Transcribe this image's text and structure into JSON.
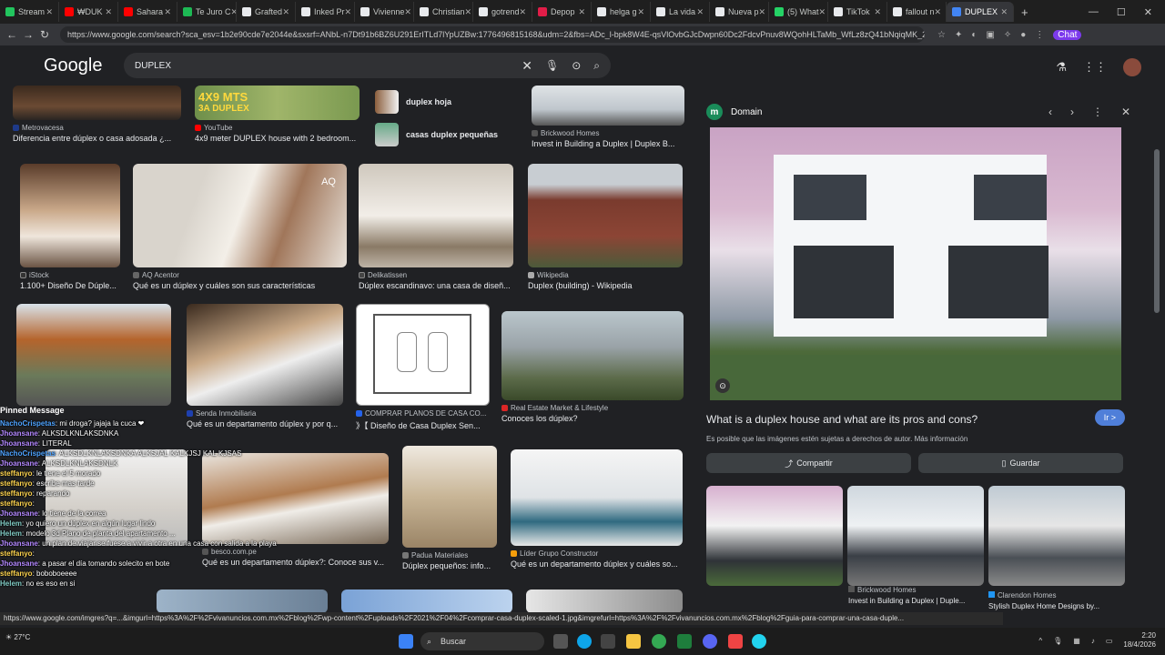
{
  "tabs": [
    {
      "label": "Stream",
      "color": "#22c55e"
    },
    {
      "label": "₩DUK",
      "color": "#ff0000"
    },
    {
      "label": "Sahara",
      "color": "#ff0000"
    },
    {
      "label": "Te Juro C",
      "color": "#1db954"
    },
    {
      "label": "Grafted",
      "color": "#e8eaed"
    },
    {
      "label": "Inked Pr",
      "color": "#e8eaed"
    },
    {
      "label": "Vivienne",
      "color": "#e8eaed"
    },
    {
      "label": "Christian",
      "color": "#e8eaed"
    },
    {
      "label": "gotrend",
      "color": "#e8eaed"
    },
    {
      "label": "Depop",
      "color": "#e11d48"
    },
    {
      "label": "helga g",
      "color": "#e8eaed"
    },
    {
      "label": "La vida",
      "color": "#e8eaed"
    },
    {
      "label": "Nueva p",
      "color": "#e8eaed"
    },
    {
      "label": "(5) What",
      "color": "#25d366"
    },
    {
      "label": "TikTok",
      "color": "#e8eaed"
    },
    {
      "label": "fallout n",
      "color": "#e8eaed"
    },
    {
      "label": "DUPLEX",
      "color": "#4285f4"
    }
  ],
  "address": {
    "url": "https://www.google.com/search?sca_esv=1b2e90cde7e2044e&sxsrf=ANbL-n7Dt91b6BZ6U291ErITLd7lYpUZBw:1776496815168&udm=2&fbs=ADc_l-bpk8W4E-qsVlOvbGJcDwpn60Dc2FdcvPnuv8WQohHLTaMb_WfLz8zQ41bNqiqMK_2tA..."
  },
  "google": {
    "logo": "Google",
    "query": "DUPLEX"
  },
  "results": [
    {
      "src": "Metrovacesa",
      "title": "Diferencia entre dúplex o casa adosada ¿...",
      "fav": "#1e3a8a"
    },
    {
      "src": "YouTube",
      "title": "4x9 meter DUPLEX house with 2 bedroom...",
      "fav": "#ff0000",
      "overlay": "4X9 MTS",
      "overlay2": "3A DUPLEX"
    },
    {
      "src": "Brickwood Homes",
      "title": "Invest in Building a Duplex | Duplex B...",
      "fav": "#555"
    },
    {
      "src": "iStock",
      "title": "1.100+ Diseño De Dúple...",
      "fav": "#333"
    },
    {
      "src": "AQ Acentor",
      "title": "Qué es un dúplex y cuáles son sus características",
      "fav": "#666",
      "overlay": "AQ"
    },
    {
      "src": "Delikatissen",
      "title": "Dúplex escandinavo: una casa de diseñ...",
      "fav": "#444"
    },
    {
      "src": "Wikipedia",
      "title": "Duplex (building) - Wikipedia",
      "fav": "#aaa"
    },
    {
      "src": "Senda Inmobiliaria",
      "title": "Qué es un departamento dúplex y por q...",
      "fav": "#1e40af"
    },
    {
      "src": "COMPRAR PLANOS DE CASA CO...",
      "title": "》【 Diseño de Casa Duplex Sen...",
      "fav": "#2563eb"
    },
    {
      "src": "Real Estate Market & Lifestyle",
      "title": "Conoces los dúplex?",
      "fav": "#dc2626"
    },
    {
      "src": "besco.com.pe",
      "title": "Qué es un departamento dúplex?: Conoce sus v...",
      "fav": "#555"
    },
    {
      "src": "Padua Materiales",
      "title": "Dúplex pequeños: info...",
      "fav": "#777"
    },
    {
      "src": "Líder Grupo Constructor",
      "title": "Qué es un departamento dúplex y cuáles so...",
      "fav": "#f59e0b"
    }
  ],
  "related": [
    {
      "bold": "duplex",
      "rest": " hoja"
    },
    {
      "bold": "casas duplex pequeñas",
      "rest": ""
    }
  ],
  "chat": {
    "header": "Pinned Message",
    "lines": [
      {
        "user": "NachoCrispetas",
        "msg": ": mi droga? jajaja la cuca ❤",
        "color": "#4ea3ff"
      },
      {
        "user": "Jhoansane",
        "msg": ": ALKSDLKNLAKSDNKA",
        "color": "#b388ff"
      },
      {
        "user": "Jhoansane",
        "msg": ": LITERAL",
        "color": "#b388ff"
      },
      {
        "user": "NachoCrispetas",
        "msg": ": ALKSDLKNLAKSDNKA ALKSJAL KALKJSJ KAL KJSAS",
        "color": "#4ea3ff"
      },
      {
        "user": "Jhoansane",
        "msg": ": ALKSDLKNLAKSDNLK",
        "color": "#b388ff"
      },
      {
        "user": "steffanyo",
        "msg": ": le tiene el 5 morado",
        "color": "#ffd54f"
      },
      {
        "user": "steffanyo",
        "msg": ": escribe mas tarde",
        "color": "#ffd54f"
      },
      {
        "user": "steffanyo",
        "msg": ": reparando",
        "color": "#ffd54f"
      },
      {
        "user": "steffanyo",
        "msg": ": ",
        "color": "#ffd54f"
      },
      {
        "user": "Jhoansane",
        "msg": ": lo tiene de la correa",
        "color": "#b388ff"
      },
      {
        "user": "Helem",
        "msg": ": yo quiero un dúplex en algún lugar lindo",
        "color": "#80cbc4"
      },
      {
        "user": "Helem",
        "msg": ": modelo 3d Plano de planta del apartamento ...",
        "color": "#80cbc4"
      },
      {
        "user": "Jhoansane",
        "msg": ": un plan de viajar se fuese a vivir a otra en una casa con salida a la playa",
        "color": "#b388ff"
      },
      {
        "user": "steffanyo",
        "msg": ": ",
        "color": "#ffd54f"
      },
      {
        "user": "Jhoansane",
        "msg": ": a pasar el día tomando solecito en bote",
        "color": "#b388ff"
      },
      {
        "user": "steffanyo",
        "msg": ": boboboeeee",
        "color": "#ffd54f"
      },
      {
        "user": "Helem",
        "msg": ": no es eso en si",
        "color": "#80cbc4"
      }
    ]
  },
  "panel": {
    "domain": "Domain",
    "title": "What is a duplex house and what are its pros and cons?",
    "visit": "Ir >",
    "note": "Es posible que las imágenes estén sujetas a derechos de autor.",
    "note_link": "Más información",
    "share": "Compartir",
    "save": "Guardar",
    "related": [
      {
        "src": "",
        "title": ""
      },
      {
        "src": "Brickwood Homes",
        "title": "Invest in Building a Duplex | Duple..."
      },
      {
        "src": "Clarendon Homes",
        "title": "Stylish Duplex Home Designs by..."
      }
    ]
  },
  "status_url": "https://www.google.com/imgres?q=...&imgurl=https%3A%2F%2Fvivanuncios.com.mx%2Fblog%2Fwp-content%2Fuploads%2F2021%2F04%2Fcomprar-casa-duplex-scaled-1.jpg&imgrefurl=https%3A%2F%2Fvivanuncios.com.mx%2Fblog%2Fguia-para-comprar-una-casa-duple...",
  "taskbar": {
    "search": "Buscar",
    "weather": "27°C",
    "time": "2:20",
    "date": "18/4/2026"
  }
}
